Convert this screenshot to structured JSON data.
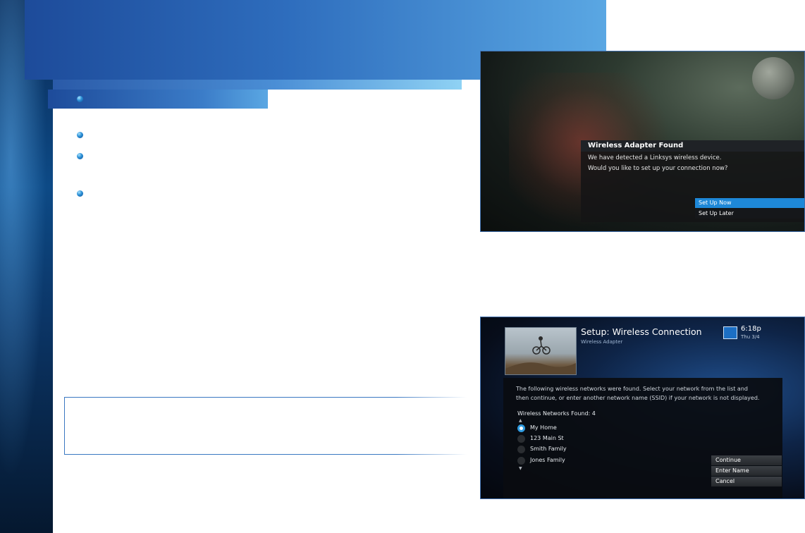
{
  "screen1": {
    "dialog_title": "Wireless Adapter Found",
    "line1": "We have detected a Linksys wireless device.",
    "line2": "Would you like to set up your connection now?",
    "options": [
      {
        "label": "Set Up Now",
        "selected": true
      },
      {
        "label": "Set Up Later",
        "selected": false
      }
    ]
  },
  "screen2": {
    "title": "Setup: Wireless Connection",
    "subtitle": "Wireless Adapter",
    "time": "6:18p",
    "date": "Thu 3/4",
    "description_line1": "The following wireless networks were found. Select your network from the list and",
    "description_line2": "then continue, or enter another network name (SSID) if your network is not displayed.",
    "networks_found_label": "Wireless Networks Found: 4",
    "networks": [
      {
        "name": "My Home",
        "selected": true
      },
      {
        "name": "123 Main St",
        "selected": false
      },
      {
        "name": "Smith Family",
        "selected": false
      },
      {
        "name": "Jones Family",
        "selected": false
      }
    ],
    "buttons": [
      "Continue",
      "Enter Name",
      "Cancel"
    ],
    "arrow_up": "▲",
    "arrow_down": "▼"
  },
  "colors": {
    "accent": "#2e6dbd",
    "selected_option": "#1e88d8"
  },
  "icons": [
    "bullet-icon",
    "radio-selected-icon",
    "radio-unselected-icon",
    "directv-logo-icon",
    "scroll-up-icon",
    "scroll-down-icon"
  ]
}
